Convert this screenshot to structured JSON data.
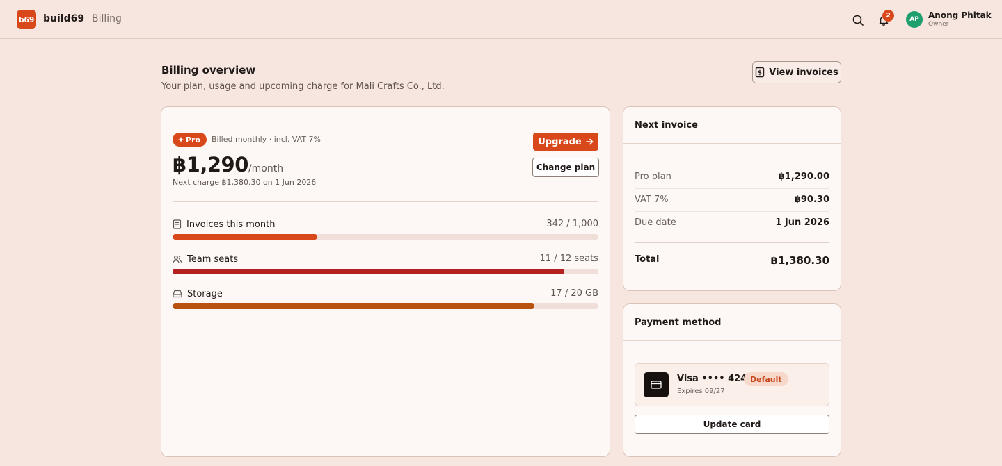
{
  "app": {
    "logo_text": "b69",
    "name": "build69",
    "breadcrumb": "Billing"
  },
  "header": {
    "notification_count": "2",
    "user": {
      "initials": "AP",
      "name": "Anong Phitak",
      "role": "Owner"
    },
    "avatar_color": "#1f9e6e"
  },
  "page": {
    "title": "Billing overview",
    "subtitle": "Your plan, usage and upcoming charge for Mali Crafts Co., Ltd.",
    "view_invoices_label": "View invoices"
  },
  "plan": {
    "badge": "Pro",
    "billing_meta": "Billed monthly · incl. VAT 7%",
    "price": "฿1,290",
    "period": "/month",
    "next_charge": "Next charge ฿1,380.30 on 1 Jun 2026",
    "upgrade_label": "Upgrade",
    "change_label": "Change plan",
    "accent_color": "#d9481a"
  },
  "usage": [
    {
      "label": "Invoices this month",
      "value": "342 / 1,000",
      "used": 342,
      "limit": 1000,
      "fill_fraction": 0.34,
      "color": "#d9481a",
      "icon": "document-icon"
    },
    {
      "label": "Team seats",
      "value": "11 / 12 seats",
      "used": 11,
      "limit": 12,
      "fill_fraction": 0.92,
      "color": "#b3201f",
      "icon": "users-icon"
    },
    {
      "label": "Storage",
      "value": "17 / 20 GB",
      "used": 17,
      "limit": 20,
      "fill_fraction": 0.85,
      "color": "#b8530f",
      "icon": "storage-icon"
    }
  ],
  "invoice": {
    "title": "Next invoice",
    "rows": [
      {
        "label": "Pro plan",
        "value": "฿1,290.00"
      },
      {
        "label": "VAT 7%",
        "value": "฿90.30"
      },
      {
        "label": "Due date",
        "value": "1 Jun 2026"
      }
    ],
    "total_label": "Total",
    "total_value": "฿1,380.30"
  },
  "payment": {
    "title": "Payment method",
    "card_label": "Visa •••• 4242",
    "default_badge": "Default",
    "expires": "Expires 09/27",
    "update_label": "Update card"
  }
}
